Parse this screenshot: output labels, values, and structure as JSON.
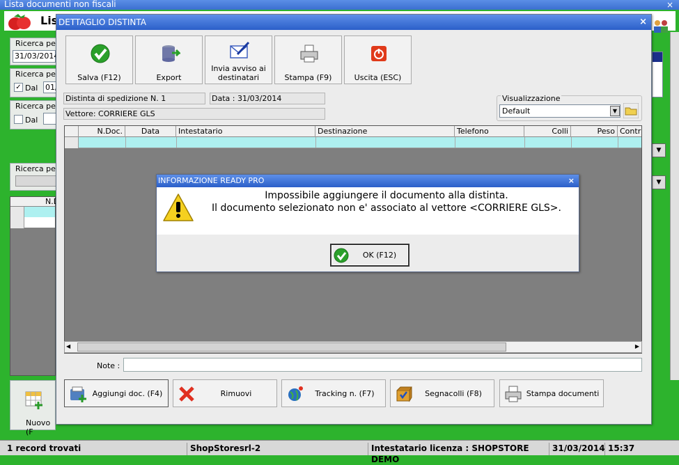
{
  "bg": {
    "title": "Lista documenti non fiscali",
    "close": "×",
    "header_title": "Lis",
    "search1_label": "Ricerca per",
    "search1_value": "31/03/2014",
    "search2_label": "Ricerca per",
    "search2_check_label": "Dal",
    "search2_value": "01/",
    "search3_label": "Ricerca per",
    "search3_check_label": "Dal",
    "search4_label": "Ricerca per",
    "grid_col": "N.D",
    "new_button": "Nuovo (F"
  },
  "status": {
    "records": "1 record trovati",
    "company": "ShopStoresrl-2",
    "license": "Intestatario licenza : SHOPSTORE DEMO",
    "date": "31/03/2014",
    "time": "15:37"
  },
  "dialog": {
    "title": "DETTAGLIO DISTINTA",
    "close": "×",
    "toolbar": [
      {
        "label": "Salva (F12)",
        "icon": "check-icon"
      },
      {
        "label": "Export",
        "icon": "database-export-icon"
      },
      {
        "label": "Invia avviso ai destinatari",
        "icon": "envelope-pen-icon"
      },
      {
        "label": "Stampa (F9)",
        "icon": "printer-icon"
      },
      {
        "label": "Uscita (ESC)",
        "icon": "exit-icon"
      }
    ],
    "distinta": "Distinta di spedizione N. 1",
    "data": "Data : 31/03/2014",
    "vettore": "Vettore: CORRIERE GLS",
    "visualizzazione_label": "Visualizzazione",
    "visualizzazione_value": "Default",
    "grid_columns": [
      "N.Doc.",
      "Data",
      "Intestatario",
      "Destinazione",
      "Telefono",
      "Colli",
      "Peso",
      "Contra"
    ],
    "note_label": "Note :",
    "note_value": "",
    "bottom_buttons": [
      {
        "label": "Aggiungi doc. (F4)",
        "icon": "add-document-icon"
      },
      {
        "label": "Rimuovi",
        "icon": "remove-x-icon"
      },
      {
        "label": "Tracking n. (F7)",
        "icon": "globe-icon"
      },
      {
        "label": "Segnacolli (F8)",
        "icon": "package-icon"
      },
      {
        "label": "Stampa documenti",
        "icon": "printer-icon"
      }
    ]
  },
  "message": {
    "title": "INFORMAZIONE READY PRO",
    "close": "×",
    "line1": "Impossibile aggiungere il documento alla distinta.",
    "line2": "Il documento selezionato non e' associato al vettore <CORRIERE GLS>.",
    "ok_label": "OK (F12)"
  },
  "colors": {
    "accent_green": "#2db32d",
    "title_blue": "#2b5fc9",
    "grid_row": "#aef0f0"
  }
}
